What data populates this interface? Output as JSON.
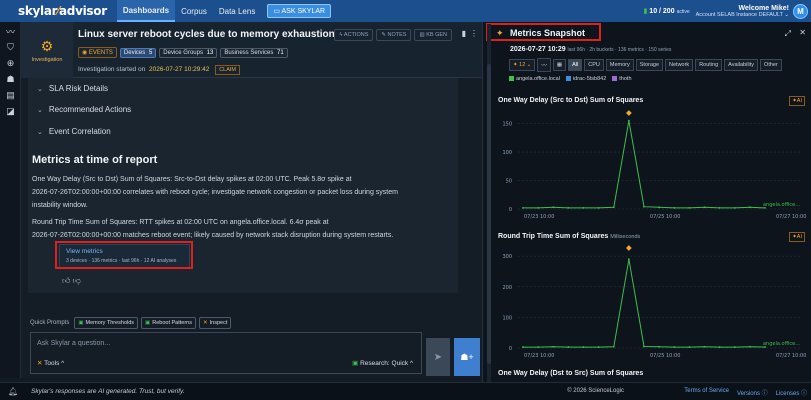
{
  "topbar": {
    "logo_main": "skylar",
    "logo_accent": "advisor",
    "nav": [
      "Dashboards",
      "Corpus",
      "Data Lens"
    ],
    "ask": "ASK SKYLAR",
    "counter_main": "10 / 200",
    "counter_sub": "active",
    "welcome": "Welcome Mike!",
    "account": "Account  SELAB  Instance DEFAULT ⌄",
    "avatar": "M"
  },
  "investigation": {
    "label": "Investigation",
    "title": "Linux server reboot cycles due to memory exhaustion",
    "buttons": [
      "ACTIONS",
      "NOTES",
      "KB GEN"
    ],
    "tags": {
      "events": "EVENTS",
      "devices_label": "Devices",
      "devices_count": "5",
      "groups_label": "Device Groups",
      "groups_count": "13",
      "services_label": "Business Services",
      "services_count": "71"
    },
    "started_label": "Investigation started on",
    "started_ts": "2026-07-27 10:29:42",
    "claim": "CLAIM"
  },
  "sections": [
    "SLA Risk Details",
    "Recommended Actions",
    "Event Correlation"
  ],
  "report": {
    "heading": "Metrics at time of report",
    "para1_l1": "One Way Delay (Src to Dst) Sum of Squares: Src-to-Dst delay spikes at 02:00 UTC. Peak 5.8σ spike at",
    "para1_l2": "2026-07-26T02:00:00+00:00 correlates with reboot cycle; investigate network congestion or packet loss during system",
    "para1_l3": "instability window.",
    "para2_l1": "Round Trip Time Sum of Squares: RTT spikes at 02:00 UTC on angela.office.local. 6.4σ peak at",
    "para2_l2": "2026-07-26T02:00:00+00:00 matches reboot event; likely caused by network stack disruption during system restarts.",
    "view_title": "View metrics",
    "view_sub": "3 devices · 136 metrics · last 96h · 12 AI analyses"
  },
  "quick_prompts": {
    "label": "Quick Prompts",
    "chips": [
      "Memory Thresholds",
      "Reboot Patterns",
      "Inspect"
    ]
  },
  "ask": {
    "placeholder": "Ask Skylar a question...",
    "tools": "Tools ^",
    "research": "Research: Quick ^"
  },
  "footer": {
    "disclaimer": "Skylar's responses are AI generated. Trust, but verify.",
    "copyright": "© 2026 ScienceLogic",
    "links": [
      "Terms of Service",
      "Versions ⓘ",
      "Licenses ⓘ"
    ]
  },
  "snapshot": {
    "title": "Metrics Snapshot",
    "date": "2026-07-27 10:29",
    "meta": "last 96h · 2h buckets · 136 metrics · 150 series",
    "ai_count": "12",
    "filters": [
      "All",
      "CPU",
      "Memory",
      "Storage",
      "Network",
      "Routing",
      "Availability",
      "Other"
    ],
    "legend": [
      {
        "name": "angela.office.local",
        "color": "#3fbf4f"
      },
      {
        "name": "idrac-5tsb842",
        "color": "#3a8ee0"
      },
      {
        "name": "thoth",
        "color": "#9a6cd8"
      }
    ],
    "colors": {
      "series": "#3fbf4f",
      "marker": "#f3a82c",
      "grid": "#2a3644"
    }
  },
  "chart_data": [
    {
      "type": "line",
      "title": "One Way Delay (Src to Dst) Sum of Squares",
      "ai_badge": "AI",
      "x": [
        "07/25 00:00",
        "07/25 04:00",
        "07/25 08:00",
        "07/25 12:00",
        "07/25 16:00",
        "07/25 20:00",
        "07/26 00:00",
        "07/26 02:00",
        "07/26 04:00",
        "07/26 08:00",
        "07/26 12:00",
        "07/26 16:00",
        "07/26 20:00",
        "07/27 00:00",
        "07/27 04:00",
        "07/27 08:00",
        "07/27 10:00"
      ],
      "x_ticks": [
        "07/23 10:00",
        "07/25 10:00",
        "07/27 10:00"
      ],
      "yticks": [
        0,
        50,
        100,
        150
      ],
      "ylim": [
        0,
        165
      ],
      "series": [
        {
          "name": "angela.office...",
          "values": [
            2,
            2,
            3,
            2,
            2,
            2,
            3,
            155,
            4,
            3,
            2,
            2,
            3,
            2,
            2,
            3,
            2
          ]
        }
      ],
      "peak_index": 7
    },
    {
      "type": "line",
      "title": "Round Trip Time Sum of Squares",
      "unit": "Milliseconds",
      "ai_badge": "AI",
      "x": [
        "07/25 00:00",
        "07/25 04:00",
        "07/25 08:00",
        "07/25 12:00",
        "07/25 16:00",
        "07/25 20:00",
        "07/26 00:00",
        "07/26 02:00",
        "07/26 04:00",
        "07/26 08:00",
        "07/26 12:00",
        "07/26 16:00",
        "07/26 20:00",
        "07/27 00:00",
        "07/27 04:00",
        "07/27 08:00",
        "07/27 10:00"
      ],
      "x_ticks": [
        "07/23 10:00",
        "07/25 10:00",
        "07/27 10:00"
      ],
      "yticks": [
        0,
        100,
        200,
        300
      ],
      "ylim": [
        0,
        320
      ],
      "series": [
        {
          "name": "angela.office...",
          "values": [
            3,
            3,
            4,
            3,
            3,
            3,
            4,
            290,
            5,
            4,
            3,
            3,
            4,
            3,
            3,
            4,
            3
          ]
        }
      ],
      "peak_index": 7
    },
    {
      "type": "line",
      "title": "One Way Delay (Dst to Src) Sum of Squares"
    }
  ]
}
